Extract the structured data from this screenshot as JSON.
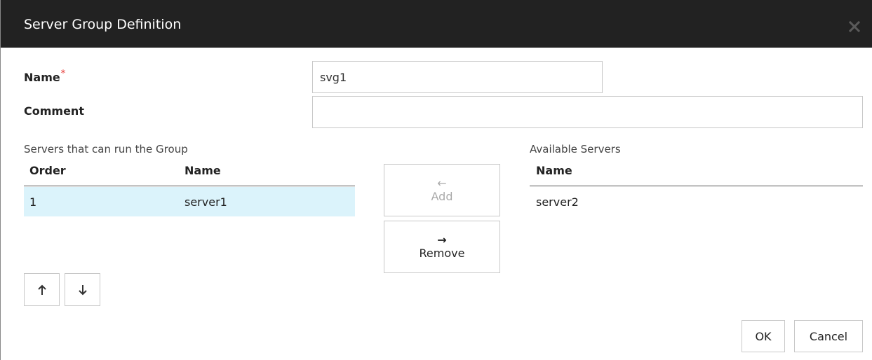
{
  "dialog": {
    "title": "Server Group Definition",
    "close_icon": "close-icon"
  },
  "form": {
    "name_label": "Name",
    "required_mark": "*",
    "name_value": "svg1",
    "comment_label": "Comment",
    "comment_value": ""
  },
  "left_list": {
    "section_label": "Servers that can run the Group",
    "columns": [
      "Order",
      "Name"
    ],
    "rows": [
      {
        "order": "1",
        "name": "server1",
        "selected": true
      }
    ]
  },
  "right_list": {
    "section_label": "Available Servers",
    "columns": [
      "Name"
    ],
    "rows": [
      {
        "name": "server2"
      }
    ]
  },
  "transfer": {
    "add_glyph": "←",
    "add_label": "Add",
    "add_enabled": false,
    "remove_glyph": "→",
    "remove_label": "Remove",
    "remove_enabled": true
  },
  "reorder": {
    "up_icon": "arrow-up-icon",
    "down_icon": "arrow-down-icon"
  },
  "footer": {
    "ok_label": "OK",
    "cancel_label": "Cancel"
  },
  "colors": {
    "titlebar": "#222222",
    "selected_row": "#dbf3fb",
    "required_mark": "#e53935",
    "disabled_text": "#aaaaaa"
  }
}
